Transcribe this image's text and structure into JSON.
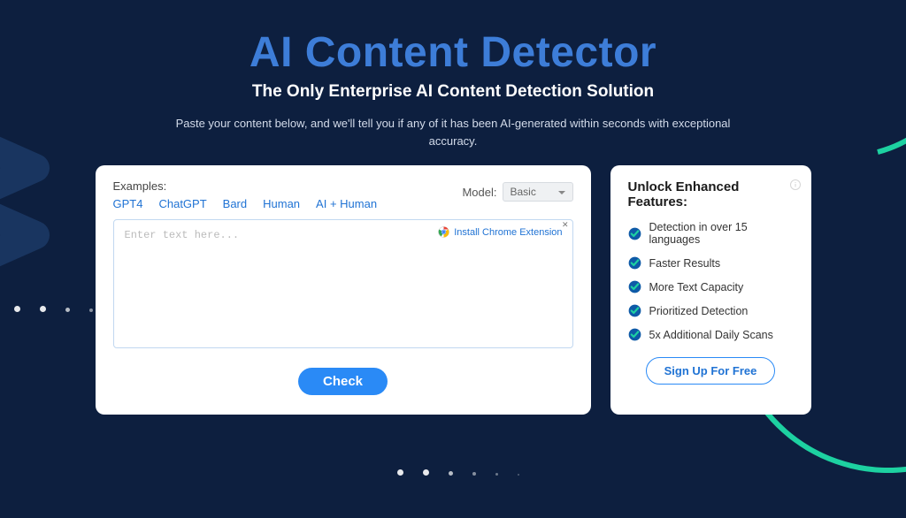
{
  "header": {
    "title": "AI Content Detector",
    "subtitle": "The Only Enterprise AI Content Detection Solution",
    "description": "Paste your content below, and we'll tell you if any of it has been AI-generated within seconds with exceptional accuracy."
  },
  "left": {
    "examples_label": "Examples:",
    "examples": [
      "GPT4",
      "ChatGPT",
      "Bard",
      "Human",
      "AI + Human"
    ],
    "model_label": "Model:",
    "model_value": "Basic",
    "textarea_placeholder": "Enter text here...",
    "chrome_label": "Install Chrome Extension",
    "check_button": "Check"
  },
  "right": {
    "title": "Unlock Enhanced Features:",
    "features": [
      "Detection in over 15 languages",
      "Faster Results",
      "More Text Capacity",
      "Prioritized Detection",
      "5x Additional Daily Scans"
    ],
    "signup": "Sign Up For Free"
  }
}
